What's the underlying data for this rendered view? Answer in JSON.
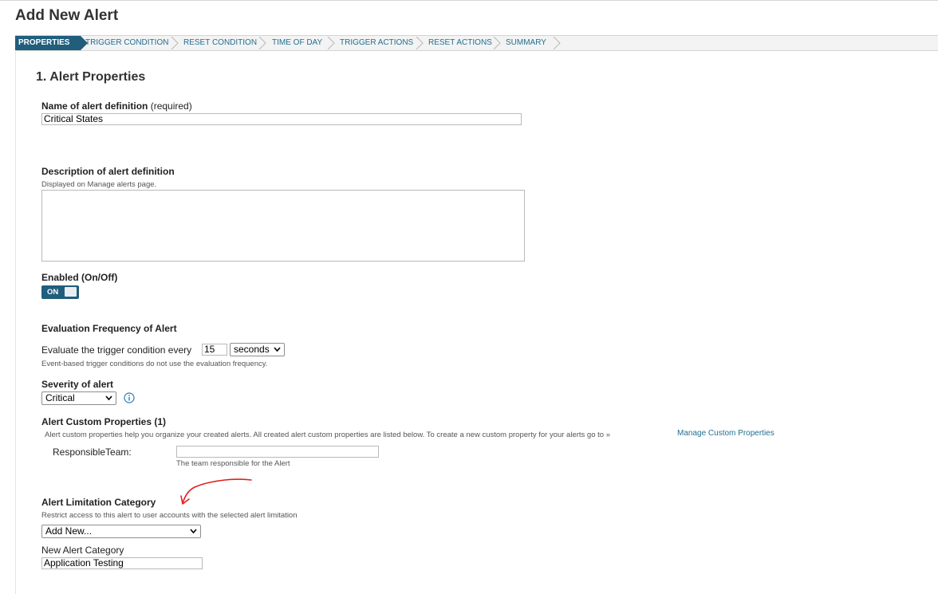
{
  "page": {
    "title": "Add New Alert"
  },
  "wizard": {
    "steps": [
      {
        "label": "PROPERTIES",
        "active": true
      },
      {
        "label": "TRIGGER CONDITION",
        "active": false
      },
      {
        "label": "RESET CONDITION",
        "active": false
      },
      {
        "label": "TIME OF DAY",
        "active": false
      },
      {
        "label": "TRIGGER ACTIONS",
        "active": false
      },
      {
        "label": "RESET ACTIONS",
        "active": false
      },
      {
        "label": "SUMMARY",
        "active": false
      }
    ]
  },
  "section": {
    "title": "1. Alert Properties"
  },
  "name_field": {
    "label": "Name of alert definition",
    "qualifier": "(required)",
    "value": "Critical States"
  },
  "description_field": {
    "label": "Description of alert definition",
    "hint": "Displayed on Manage alerts page.",
    "value": ""
  },
  "enabled": {
    "label": "Enabled (On/Off)",
    "state_label": "ON",
    "on": true
  },
  "evaluation": {
    "label": "Evaluation Frequency of Alert",
    "prefix": "Evaluate the trigger condition every",
    "value": "15",
    "unit": "seconds",
    "hint": "Event-based trigger conditions do not use the evaluation frequency."
  },
  "severity": {
    "label": "Severity of alert",
    "value": "Critical"
  },
  "custom_properties": {
    "label": "Alert Custom Properties (1)",
    "hint": "Alert custom properties help you organize your created alerts. All created alert custom properties are listed below. To create a new custom property for your alerts go to »",
    "link": "Manage Custom Properties",
    "field_label": "ResponsibleTeam:",
    "field_value": "",
    "field_hint": "The team responsible for the Alert"
  },
  "limitation": {
    "label": "Alert Limitation Category",
    "hint": "Restrict access to this alert to user accounts with the selected alert limitation",
    "value": "Add New...",
    "new_label": "New Alert Category",
    "new_value": "Application Testing"
  },
  "colors": {
    "accent": "#205e7c",
    "link": "#1f6f93",
    "annotation": "#e02020"
  },
  "icons": {
    "info": "info-icon",
    "caret": "chevron-down-icon",
    "annotation": "hand-drawn-arrow"
  }
}
